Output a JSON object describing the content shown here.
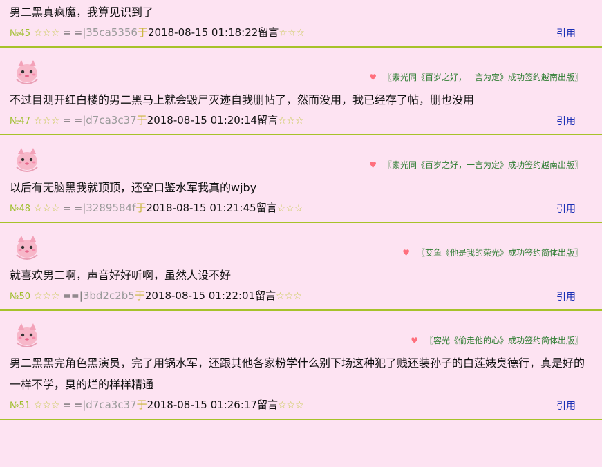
{
  "posts": [
    {
      "has_avatar": false,
      "signature": "",
      "content": "男二黑真疯魔，我算见识到了",
      "number": "№45",
      "stars_left": "☆☆☆",
      "equals": "=  =",
      "uid": "35ca5356",
      "yu": "于",
      "datetime": "2018-08-15 01:18:22",
      "liuyan": "留言",
      "stars_right": "☆☆☆",
      "quote_label": "引用"
    },
    {
      "has_avatar": true,
      "signature": "〖素光同《百岁之好，一言为定》成功签约越南出版〗",
      "content": "不过目测开红白楼的男二黑马上就会毁尸灭迹自我删帖了，然而没用，我已经存了帖，删也没用",
      "number": "№47",
      "stars_left": "☆☆☆",
      "equals": "=  =",
      "uid": "d7ca3c37",
      "yu": "于",
      "datetime": "2018-08-15 01:20:14",
      "liuyan": "留言",
      "stars_right": "☆☆☆",
      "quote_label": "引用"
    },
    {
      "has_avatar": true,
      "signature": "〖素光同《百岁之好，一言为定》成功签约越南出版〗",
      "content": "以后有无脑黑我就顶顶，还空口鉴水军我真的wjby",
      "number": "№48",
      "stars_left": "☆☆☆",
      "equals": "=  =",
      "uid": "3289584f",
      "yu": "于",
      "datetime": "2018-08-15 01:21:45",
      "liuyan": "留言",
      "stars_right": "☆☆☆",
      "quote_label": "引用"
    },
    {
      "has_avatar": true,
      "signature": "〖艾鱼《他是我的荣光》成功签约简体出版〗",
      "content": "就喜欢男二啊，声音好好听啊，虽然人设不好",
      "number": "№50",
      "stars_left": "☆☆☆",
      "equals": "==",
      "uid": "3bd2c2b5",
      "yu": "于",
      "datetime": "2018-08-15 01:22:01",
      "liuyan": "留言",
      "stars_right": "☆☆☆",
      "quote_label": "引用"
    },
    {
      "has_avatar": true,
      "signature": "〖容光《偷走他的心》成功签约简体出版〗",
      "content": "男二黑黑完角色黑演员，完了用锅水军，还跟其他各家粉学什么别下场这种犯了贱还装孙子的白莲婊臭德行，真是好的一样不学，臭的烂的样样精通",
      "number": "№51",
      "stars_left": "☆☆☆",
      "equals": "=  =",
      "uid": "d7ca3c37",
      "yu": "于",
      "datetime": "2018-08-15 01:26:17",
      "liuyan": "留言",
      "stars_right": "☆☆☆",
      "quote_label": "引用"
    }
  ]
}
